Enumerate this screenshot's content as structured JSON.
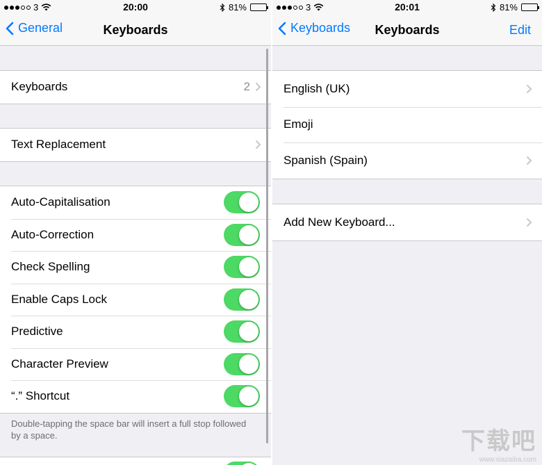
{
  "left": {
    "status": {
      "carrier": "3",
      "time": "20:00",
      "battery": "81%"
    },
    "nav": {
      "back_label": "General",
      "title": "Keyboards"
    },
    "keyboards_row": {
      "label": "Keyboards",
      "value": "2"
    },
    "text_replacement_row": {
      "label": "Text Replacement"
    },
    "toggles": [
      {
        "label": "Auto-Capitalisation",
        "on": true
      },
      {
        "label": "Auto-Correction",
        "on": true
      },
      {
        "label": "Check Spelling",
        "on": true
      },
      {
        "label": "Enable Caps Lock",
        "on": true
      },
      {
        "label": "Predictive",
        "on": true
      },
      {
        "label": "Character Preview",
        "on": true
      },
      {
        "label": "“.” Shortcut",
        "on": true
      }
    ],
    "footer_note": "Double-tapping the space bar will insert a full stop followed by a space."
  },
  "right": {
    "status": {
      "carrier": "3",
      "time": "20:01",
      "battery": "81%"
    },
    "nav": {
      "back_label": "Keyboards",
      "title": "Keyboards",
      "edit_label": "Edit"
    },
    "keyboards": [
      {
        "label": "English (UK)",
        "chevron": true
      },
      {
        "label": "Emoji",
        "chevron": false
      },
      {
        "label": "Spanish (Spain)",
        "chevron": true
      }
    ],
    "add_keyboard": {
      "label": "Add New Keyboard..."
    }
  },
  "watermark": {
    "brand": "下载吧",
    "url": "www.xiazaiba.com"
  },
  "colors": {
    "accent": "#007aff",
    "toggle_on": "#4cd964",
    "background": "#efeff4",
    "secondary_text": "#8e8e93"
  },
  "icons": [
    "signal-dots-icon",
    "wifi-icon",
    "bluetooth-icon",
    "battery-icon",
    "back-chevron-icon",
    "chevron-right-icon"
  ]
}
